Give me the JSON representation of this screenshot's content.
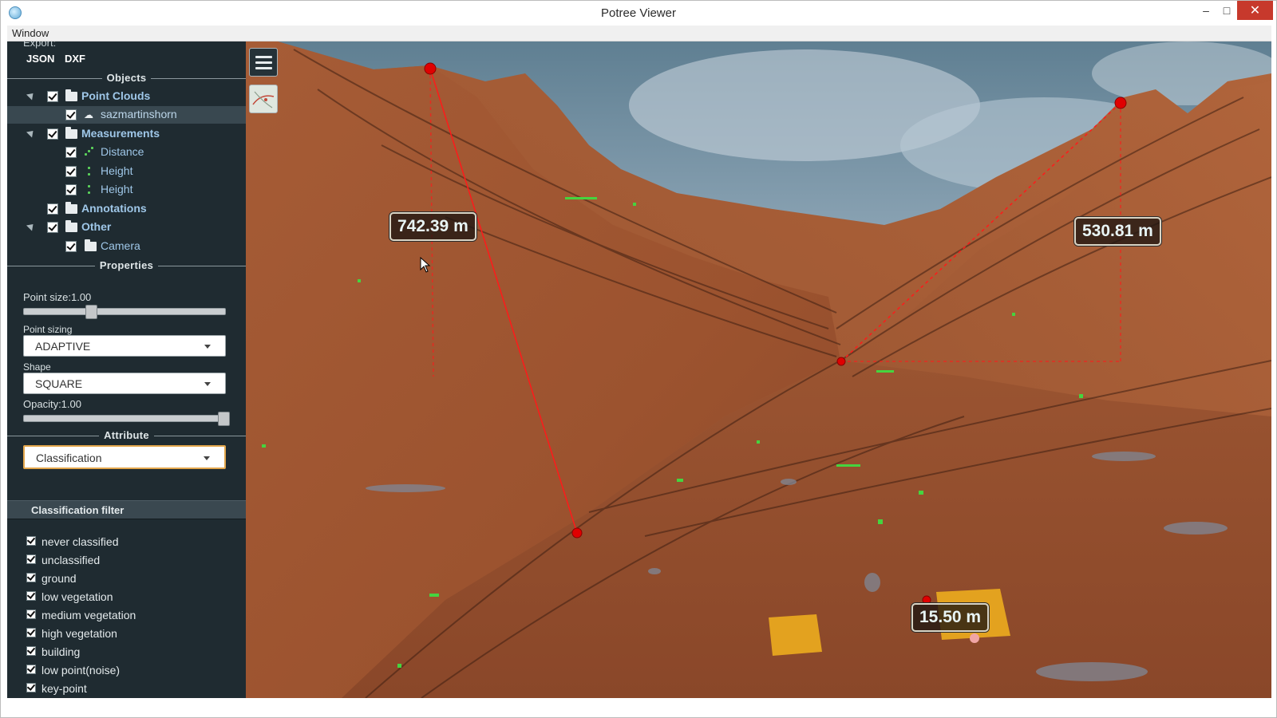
{
  "window": {
    "title": "Potree Viewer",
    "minimize": "–",
    "maximize": "□",
    "close": "✕"
  },
  "menubar": {
    "window": "Window"
  },
  "export": {
    "label": "Export:",
    "json": "JSON",
    "dxf": "DXF"
  },
  "sections": {
    "objects": "Objects",
    "properties": "Properties",
    "attribute": "Attribute"
  },
  "tree": {
    "point_clouds": "Point Clouds",
    "cloud": "sazmartinshorn",
    "measurements": "Measurements",
    "distance": "Distance",
    "height1": "Height",
    "height2": "Height",
    "annotations": "Annotations",
    "other": "Other",
    "camera": "Camera"
  },
  "properties": {
    "point_size_label": "Point size:1.00",
    "point_size": 1.0,
    "point_sizing_label": "Point sizing",
    "point_sizing": "ADAPTIVE",
    "shape_label": "Shape",
    "shape": "SQUARE",
    "opacity_label": "Opacity:1.00",
    "opacity": 1.0
  },
  "attribute": {
    "value": "Classification"
  },
  "classification_filter": {
    "title": "Classification filter",
    "items": [
      "never classified",
      "unclassified",
      "ground",
      "low vegetation",
      "medium vegetation",
      "high vegetation",
      "building",
      "low point(noise)",
      "key-point"
    ]
  },
  "measurements": {
    "m1": "742.39 m",
    "m2": "530.81 m",
    "m3": "15.50 m"
  },
  "colors": {
    "sidebar": "#1f2b31",
    "terrain": "#a45a34",
    "marker": "#e00000",
    "accent": "#9fc7e8"
  },
  "icons": {
    "menu": "hamburger-icon",
    "map": "map-icon",
    "folder": "folder-icon",
    "cloud": "cloud-icon"
  }
}
